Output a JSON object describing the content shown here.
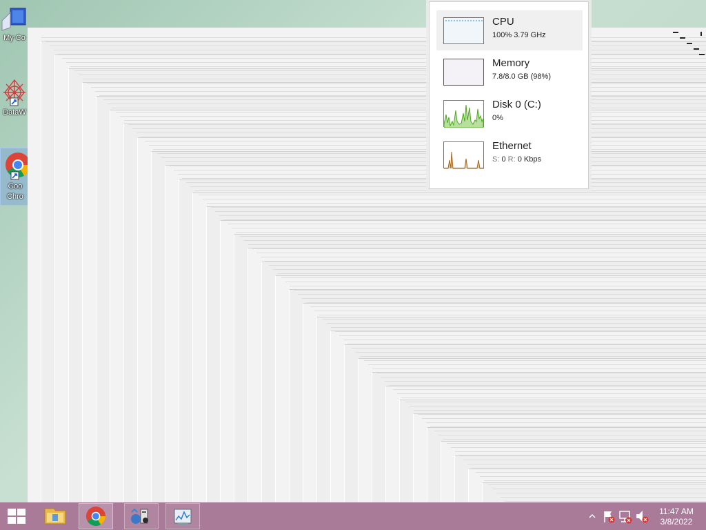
{
  "desktop": {
    "icons": [
      {
        "label": "My Co",
        "icon": "computer-icon"
      },
      {
        "label": "DataW",
        "icon": "datawarrior-icon"
      },
      {
        "label": "Goo",
        "label2": "Chro",
        "icon": "chrome-icon"
      }
    ]
  },
  "perf_popup": {
    "items": [
      {
        "title": "CPU",
        "sub": "100%  3.79 GHz",
        "color": "#1a8cd8",
        "fill": "#f1f6fb"
      },
      {
        "title": "Memory",
        "sub": "7.8/8.0 GB (98%)",
        "color": "#8b2ea6",
        "fill": "#f4f2f6"
      },
      {
        "title": "Disk 0 (C:)",
        "sub": "0%",
        "color": "#4ba81e",
        "fill": "#ffffff"
      },
      {
        "title": "Ethernet",
        "sub_s_label": "S:",
        "sub_s": "0",
        "sub_r_label": "R:",
        "sub_r": "0 Kbps",
        "color": "#a6651d",
        "fill": "#ffffff"
      }
    ]
  },
  "taskbar": {
    "start": "windows-start-icon",
    "apps": [
      {
        "name": "File Explorer",
        "icon": "folder-icon",
        "state": "pinned"
      },
      {
        "name": "Google Chrome",
        "icon": "chrome-icon",
        "state": "active"
      },
      {
        "name": "Network app",
        "icon": "network-app-icon",
        "state": "running"
      },
      {
        "name": "Task Manager",
        "icon": "task-manager-icon",
        "state": "running"
      }
    ],
    "tray": {
      "time": "11:47 AM",
      "date": "3/8/2022"
    }
  },
  "colors": {
    "taskbar": "#a97b98",
    "cpu": "#1a8cd8",
    "memory": "#8b2ea6",
    "disk": "#4ba81e",
    "ethernet": "#a6651d"
  }
}
